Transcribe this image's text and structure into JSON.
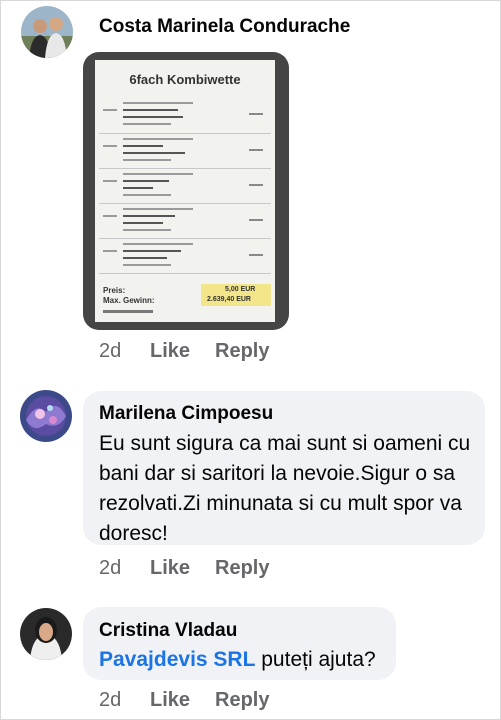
{
  "comments": [
    {
      "author": "Costa Marinela Condurache",
      "image_content": {
        "title": "6fach Kombiwette",
        "total_label": "Preis:",
        "total_value": "5,00 EUR",
        "win_label": "Max. Gewinn:",
        "win_value": "2.639,40 EUR"
      },
      "time": "2d",
      "like_label": "Like",
      "reply_label": "Reply"
    },
    {
      "author": "Marilena Cimpoesu",
      "text": "Eu sunt sigura ca mai sunt si oameni cu bani dar si saritori la nevoie.Sigur o sa rezolvati.Zi minunata si cu mult spor va doresc!",
      "time": "2d",
      "like_label": "Like",
      "reply_label": "Reply"
    },
    {
      "author": "Cristina Vladau",
      "mention": "Pavajdevis SRL",
      "text": " puteți ajuta?",
      "time": "2d",
      "like_label": "Like",
      "reply_label": "Reply"
    }
  ]
}
